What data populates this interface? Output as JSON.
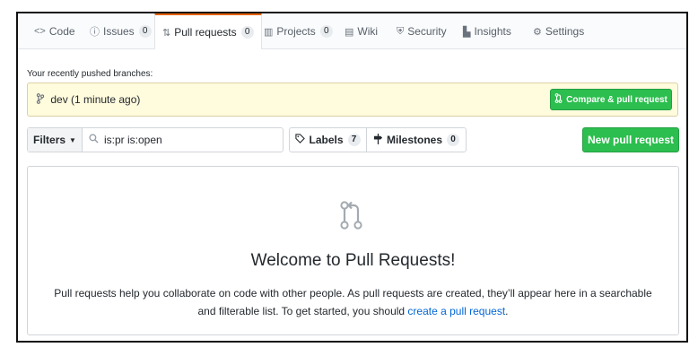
{
  "tabs": [
    {
      "icon": "<>",
      "label": "Code",
      "counter": null
    },
    {
      "icon": "ⓘ",
      "label": "Issues",
      "counter": "0"
    },
    {
      "icon": "⇅",
      "label": "Pull requests",
      "counter": "0"
    },
    {
      "icon": "▥",
      "label": "Projects",
      "counter": "0"
    },
    {
      "icon": "▤",
      "label": "Wiki",
      "counter": null
    },
    {
      "icon": "⛨",
      "label": "Security",
      "counter": null
    },
    {
      "icon": "▙",
      "label": "Insights",
      "counter": null
    },
    {
      "icon": "⚙",
      "label": "Settings",
      "counter": null
    }
  ],
  "selected_tab": "Pull requests",
  "recent": {
    "label": "Your recently pushed branches:",
    "branch_icon": "branch-icon",
    "branch_text": "dev (1 minute ago)",
    "compare_label": "Compare & pull request"
  },
  "toolbar": {
    "filters_label": "Filters",
    "search_value": "is:pr is:open",
    "labels_label": "Labels",
    "labels_count": "7",
    "milestones_label": "Milestones",
    "milestones_count": "0",
    "new_pr_label": "New pull request"
  },
  "blankslate": {
    "title": "Welcome to Pull Requests!",
    "line1": "Pull requests help you collaborate on code with other people. As pull requests are created, they’ll appear here in a searchable",
    "line2_prefix": "and filterable list. To get started, you should ",
    "line2_link": "create a pull request",
    "line2_suffix": "."
  },
  "colors": {
    "accent_tab": "#e36209",
    "green_button": "#2cbe4e",
    "banner_bg": "#fffbdd",
    "link": "#0366d6"
  }
}
